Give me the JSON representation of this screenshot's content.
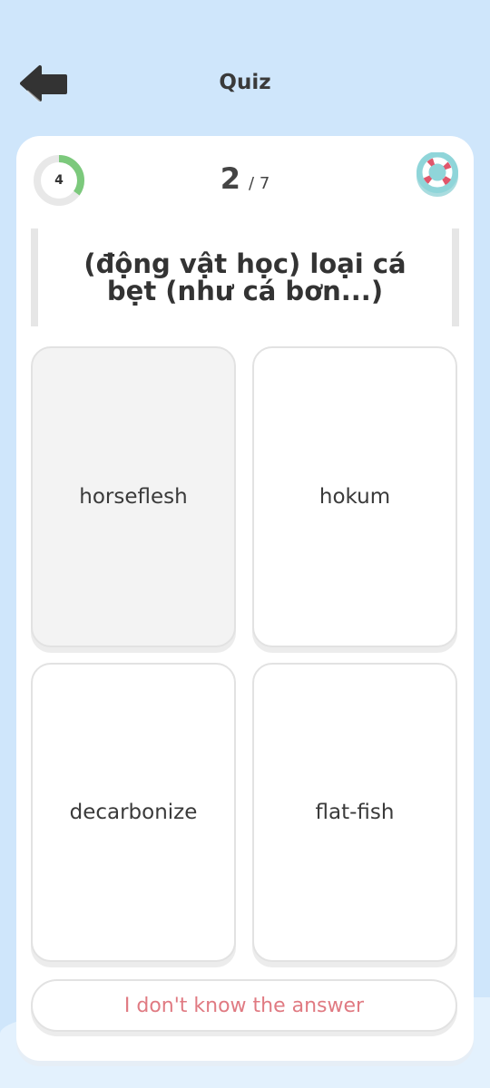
{
  "header": {
    "title": "Quiz",
    "back_icon": "back-arrow-icon"
  },
  "progress": {
    "ring_value": "4",
    "ring_fraction": 0.35,
    "ring_color": "#7cc97c",
    "current": "2",
    "total": "/ 7"
  },
  "help": {
    "icon": "lifebuoy-icon",
    "color": "#8fd5d9"
  },
  "question": {
    "text": "(động vật học) loại cá bẹt (như cá bơn...)"
  },
  "options": [
    {
      "label": "horseflesh",
      "selected": true
    },
    {
      "label": "hokum",
      "selected": false
    },
    {
      "label": "decarbonize",
      "selected": false
    },
    {
      "label": "flat-fish",
      "selected": false
    }
  ],
  "footer": {
    "dont_know_label": "I don't know the answer",
    "accent_color": "#e07a82"
  }
}
